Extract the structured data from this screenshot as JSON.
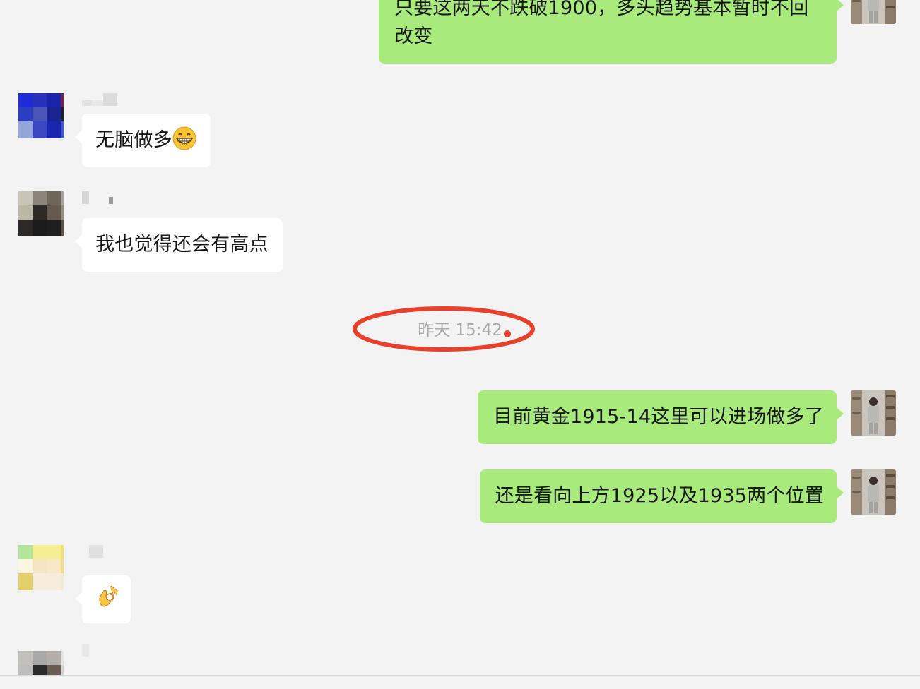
{
  "messages": [
    {
      "id": "m1",
      "direction": "outgoing",
      "text": "只要这两天不跌破1900，多头趋势基本暂时不回改变"
    },
    {
      "id": "m2",
      "direction": "incoming",
      "text": "无脑做多",
      "emoji": "grinning-face-with-teeth"
    },
    {
      "id": "m3",
      "direction": "incoming",
      "text": "我也觉得还会有高点"
    },
    {
      "id": "m4",
      "direction": "outgoing",
      "text": "目前黄金1915-14这里可以进场做多了"
    },
    {
      "id": "m5",
      "direction": "outgoing",
      "text": "还是看向上方1925以及1935两个位置"
    },
    {
      "id": "m6",
      "direction": "incoming",
      "text": "",
      "emoji": "ok-hand"
    }
  ],
  "timestamp": "昨天 15:42",
  "colors": {
    "background": "#f3f3f3",
    "outgoing_bubble": "#a8ea7b",
    "incoming_bubble": "#ffffff",
    "timestamp_text": "#a8a8a8",
    "highlight_ring": "#e8402b"
  }
}
